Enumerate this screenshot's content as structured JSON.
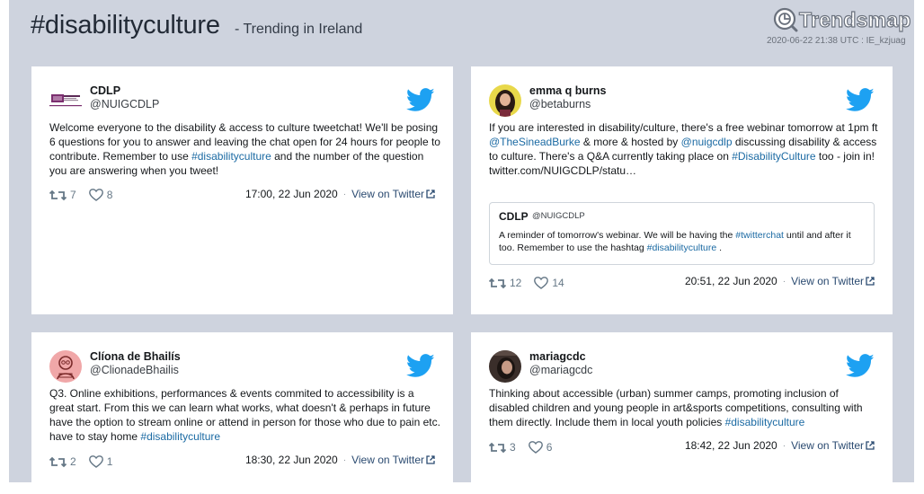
{
  "header": {
    "hashtag": "#disabilityculture",
    "subtitle": "- Trending in Ireland",
    "logo_text": "Trendsmap",
    "meta": "2020-06-22 21:38 UTC : IE_kzjuag"
  },
  "colors": {
    "background": "#ced3de",
    "twitter_blue": "#1da1f2",
    "link": "#1b6aa3"
  },
  "tweets": [
    {
      "name": "CDLP",
      "handle": "@NUIGCDLP",
      "avatar_label": "NUI Galway",
      "text_parts": [
        "Welcome everyone to the disability & access to culture tweetchat! We'll be posing 6 questions for you to answer and leaving the chat open for 24 hours for people to contribute. Remember to use ",
        "#disabilityculture",
        " and the number of the question you are answering when you tweet!"
      ],
      "retweets": "7",
      "likes": "8",
      "timestamp": "17:00, 22 Jun 2020",
      "view_label": "View on Twitter"
    },
    {
      "name": "emma q burns",
      "handle": "@betaburns",
      "text_parts": [
        "If you are interested in disability/culture, there's a free webinar tomorrow at 1pm ft ",
        "@TheSineadBurke",
        " & more & hosted by ",
        "@nuigcdlp",
        " discussing disability & access to culture. There's a Q&A currently taking place on ",
        "#DisabilityCulture",
        " too - join in!"
      ],
      "link_text": "twitter.com/NUIGCDLP/statu…",
      "quote": {
        "name": "CDLP",
        "handle": "@NUIGCDLP",
        "text_parts": [
          "A reminder of tomorrow's webinar. We will be having the ",
          "#twitterchat",
          " until and after it too. Remember to use the hashtag ",
          "#disabilityculture",
          " ."
        ]
      },
      "retweets": "12",
      "likes": "14",
      "timestamp": "20:51, 22 Jun 2020",
      "view_label": "View on Twitter"
    },
    {
      "name": "Clíona de Bhailís",
      "handle": "@ClionadeBhailis",
      "text_parts": [
        "Q3. Online exhibitions, performances & events commited to accessibility is a great start. From this we can learn what works, what doesn't & perhaps in future have the option to stream online or attend in person for those who due to pain etc. have to stay home ",
        "#disabilityculture"
      ],
      "retweets": "2",
      "likes": "1",
      "timestamp": "18:30, 22 Jun 2020",
      "view_label": "View on Twitter"
    },
    {
      "name": "mariagcdc",
      "handle": "@mariagcdc",
      "text_parts": [
        "Thinking about accessible (urban) summer camps, promoting inclusion of disabled children and young people in art&sports competitions, consulting with them directly. Include them in local youth policies ",
        "#disabilityculture"
      ],
      "retweets": "3",
      "likes": "6",
      "timestamp": "18:42, 22 Jun 2020",
      "view_label": "View on Twitter"
    }
  ]
}
